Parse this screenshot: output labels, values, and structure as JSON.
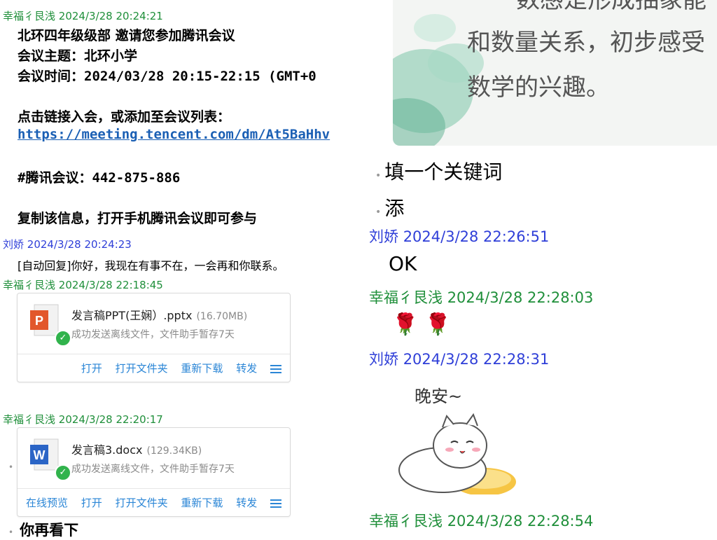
{
  "messages": {
    "m1": {
      "sender": "幸福彳艮浅",
      "time": "2024/3/28 20:24:21"
    },
    "invite": {
      "line1": "北环四年级级部 邀请您参加腾讯会议",
      "topic": "会议主题：北环小学",
      "time": "会议时间：2024/03/28 20:15-22:15 (GMT+0",
      "join_hint": "点击链接入会，或添加至会议列表：",
      "link": "https://meeting.tencent.com/dm/At5BaHhv",
      "meeting_id": "#腾讯会议：442-875-886",
      "copy_hint": "复制该信息，打开手机腾讯会议即可参与"
    },
    "m2": {
      "sender": "刘娇",
      "time": "2024/3/28 20:24:23",
      "text": "[自动回复]你好，我现在有事不在，一会再和你联系。"
    },
    "m3": {
      "sender": "幸福彳艮浅",
      "time": "2024/3/28 22:18:45"
    },
    "file1": {
      "name": "发言稿PPT(王娴）.pptx",
      "size": "(16.70MB)",
      "status": "成功发送离线文件，文件助手暂存7天",
      "actions": [
        "打开",
        "打开文件夹",
        "重新下载",
        "转发"
      ]
    },
    "m4": {
      "sender": "幸福彳艮浅",
      "time": "2024/3/28 22:20:17"
    },
    "file2": {
      "name": "发言稿3.docx",
      "size": "(129.34KB)",
      "status": "成功发送离线文件，文件助手暂存7天",
      "actions": [
        "在线预览",
        "打开",
        "打开文件夹",
        "重新下载",
        "转发"
      ]
    },
    "m5_text": "你再看下",
    "image_text_1": "数感是形成抽象能",
    "image_text_2": "和数量关系，初步感受",
    "image_text_3": "数学的兴趣。",
    "item1": "填一个关键词",
    "item2": "添",
    "m6": {
      "sender": "刘娇",
      "time": "2024/3/28 22:26:51",
      "text": "OK"
    },
    "m7": {
      "sender": "幸福彳艮浅",
      "time": "2024/3/28 22:28:03",
      "emoji": "🌹 🌹"
    },
    "m8": {
      "sender": "刘娇",
      "time": "2024/3/28 22:28:31",
      "sticker_text": "晚安~"
    },
    "m9": {
      "sender": "幸福彳艮浅",
      "time": "2024/3/28 22:28:54"
    }
  },
  "colors": {
    "self_name": "#1f8f3a",
    "other_name": "#2f3fd8",
    "link": "#1a5fb4",
    "action": "#2b86d6"
  }
}
